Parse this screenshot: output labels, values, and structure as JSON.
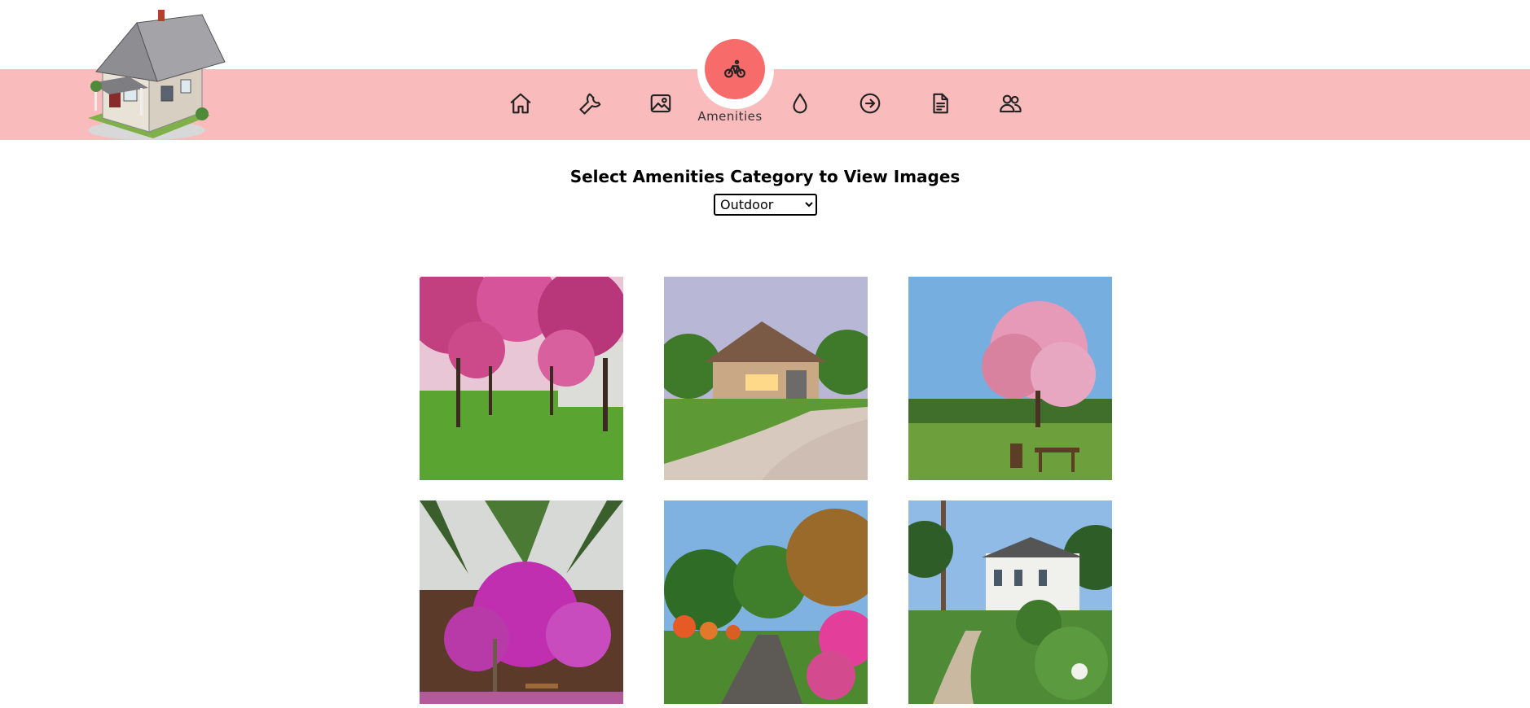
{
  "nav": {
    "items": [
      {
        "icon": "home-icon"
      },
      {
        "icon": "wrench-icon"
      },
      {
        "icon": "image-icon"
      },
      {
        "icon": "bicycle-icon",
        "label": "Amenities",
        "active": true
      },
      {
        "icon": "water-drop-icon"
      },
      {
        "icon": "arrow-right-circle-icon"
      },
      {
        "icon": "document-icon"
      },
      {
        "icon": "users-icon"
      }
    ],
    "active_label": "Amenities"
  },
  "main": {
    "title": "Select Amenities Category to View Images",
    "select": {
      "value": "Outdoor",
      "options": [
        "Outdoor"
      ]
    }
  },
  "gallery": {
    "images": [
      {
        "subject": "cherry blossom tree-lined lawn"
      },
      {
        "subject": "stone house with driveway"
      },
      {
        "subject": "pink flowering tree with garden table"
      },
      {
        "subject": "bougainvillea and palm patio"
      },
      {
        "subject": "garden path with flowering shrubs"
      },
      {
        "subject": "white mansion with landscaped garden"
      }
    ]
  },
  "colors": {
    "band": "#f9bbbb",
    "active": "#f76b6b"
  }
}
